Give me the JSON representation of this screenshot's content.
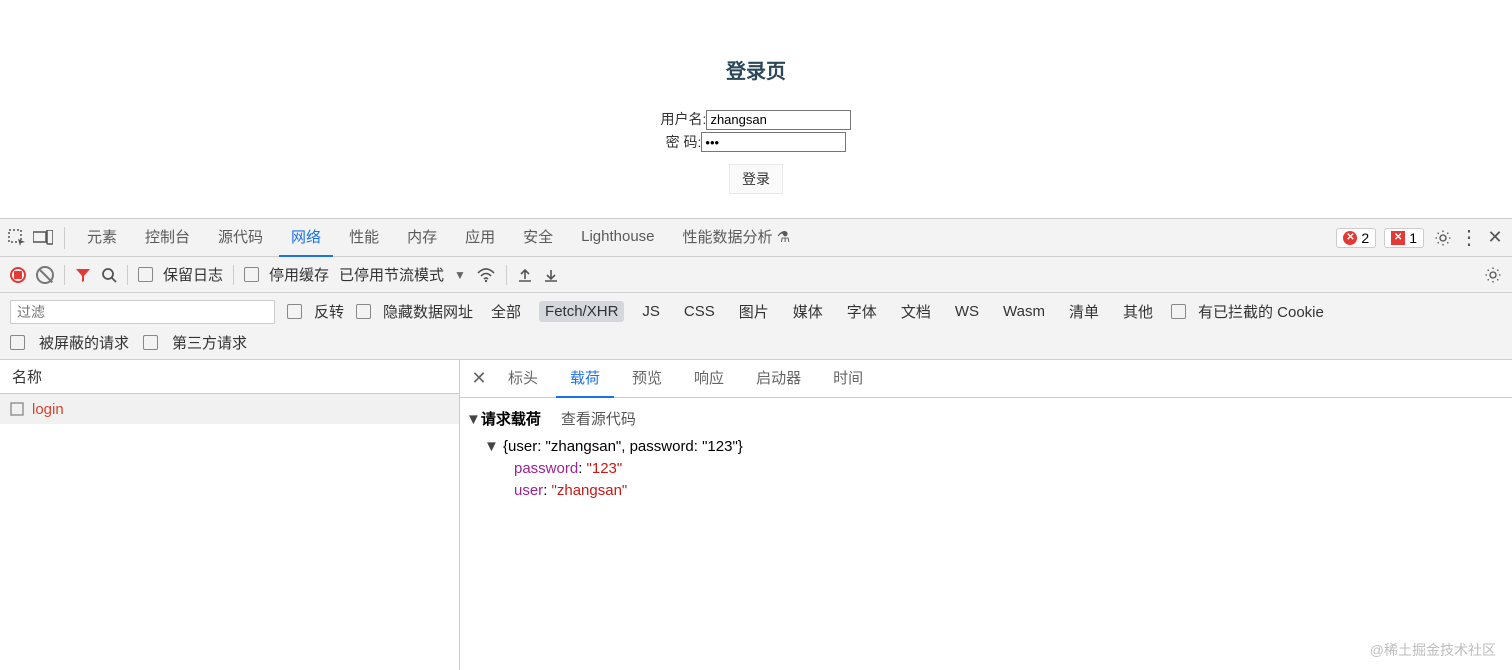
{
  "page": {
    "title": "登录页",
    "username_label": "用户名:",
    "password_label": "密 码:",
    "username_value": "zhangsan",
    "password_value": "•••",
    "login_btn": "登录"
  },
  "devtools": {
    "tabs": [
      "元素",
      "控制台",
      "源代码",
      "网络",
      "性能",
      "内存",
      "应用",
      "安全",
      "Lighthouse",
      "性能数据分析"
    ],
    "active_tab_index": 3,
    "errors": "2",
    "issues": "1",
    "toolbar2": {
      "preserve_log": "保留日志",
      "disable_cache": "停用缓存",
      "throttling": "已停用节流模式"
    },
    "filter": {
      "placeholder": "过滤",
      "invert": "反转",
      "hide_data_urls": "隐藏数据网址",
      "types": [
        "全部",
        "Fetch/XHR",
        "JS",
        "CSS",
        "图片",
        "媒体",
        "字体",
        "文档",
        "WS",
        "Wasm",
        "清单",
        "其他"
      ],
      "active_type_index": 1,
      "blocked_cookies": "有已拦截的 Cookie",
      "blocked_requests": "被屏蔽的请求",
      "third_party": "第三方请求"
    },
    "requests": {
      "header": "名称",
      "items": [
        "login"
      ]
    },
    "detail": {
      "tabs": [
        "标头",
        "载荷",
        "预览",
        "响应",
        "启动器",
        "时间"
      ],
      "active_index": 1,
      "payload_title": "请求载荷",
      "view_source": "查看源代码",
      "json_summary": "{user: \"zhangsan\", password: \"123\"}",
      "fields": [
        {
          "key": "password",
          "value": "\"123\""
        },
        {
          "key": "user",
          "value": "\"zhangsan\""
        }
      ]
    }
  },
  "watermark": "@稀土掘金技术社区"
}
